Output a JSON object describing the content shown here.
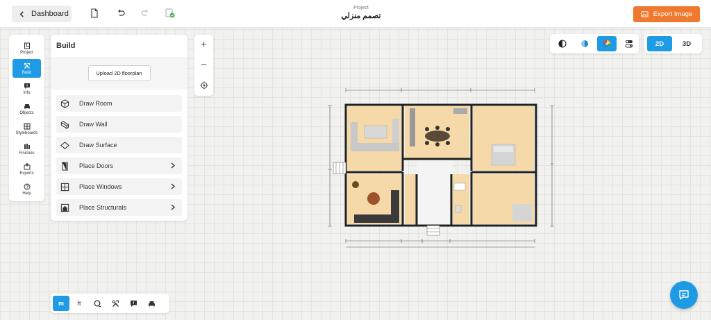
{
  "topbar": {
    "dashboard_label": "Dashboard",
    "project_label": "Project",
    "project_name": "تصمم منزلي",
    "export_label": "Export Image"
  },
  "leftnav": {
    "items": [
      {
        "label": "Project",
        "icon": "project-icon"
      },
      {
        "label": "Build",
        "icon": "build-icon",
        "active": true
      },
      {
        "label": "Info",
        "icon": "info-icon"
      },
      {
        "label": "Objects",
        "icon": "objects-icon"
      },
      {
        "label": "Styleboards",
        "icon": "styleboards-icon"
      },
      {
        "label": "Finishes",
        "icon": "finishes-icon"
      },
      {
        "label": "Exports",
        "icon": "exports-icon"
      },
      {
        "label": "Help",
        "icon": "help-icon"
      }
    ]
  },
  "build_panel": {
    "title": "Build",
    "upload_label": "Upload 2D floorplan",
    "tools": [
      {
        "label": "Draw Room",
        "icon": "cube-icon"
      },
      {
        "label": "Draw Wall",
        "icon": "wall-icon"
      },
      {
        "label": "Draw Surface",
        "icon": "surface-icon"
      },
      {
        "label": "Place Doors",
        "icon": "door-icon",
        "submenu": true
      },
      {
        "label": "Place Windows",
        "icon": "window-icon",
        "submenu": true
      },
      {
        "label": "Place Structurals",
        "icon": "structural-icon",
        "submenu": true
      }
    ]
  },
  "zoom": {
    "in": "+",
    "out": "−"
  },
  "view_modes": {
    "dim_2d": "2D",
    "dim_3d": "3D",
    "active_dim": "2D"
  },
  "units": {
    "metric": "m",
    "imperial": "ft",
    "active": "m"
  },
  "colors": {
    "accent": "#1e9be4",
    "export": "#ef7a2f",
    "floor": "#f5d9a8",
    "wall": "#222222"
  }
}
